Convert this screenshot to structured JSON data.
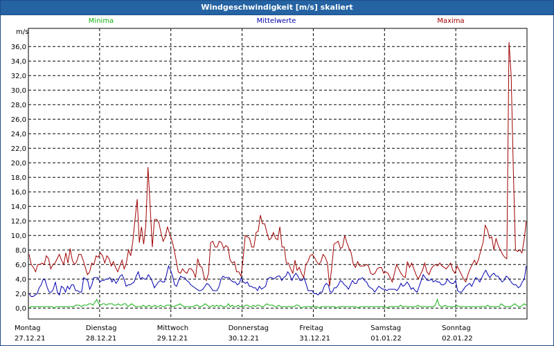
{
  "window": {
    "title": "Windgeschwindigkeit [m/s] skaliert"
  },
  "legend": {
    "minima": "Minima",
    "mittelwerte": "Mittelwerte",
    "maxima": "Maxima"
  },
  "colors": {
    "titlebar": "#2563a3",
    "minima": "#10b010",
    "mittelwerte": "#0000b0",
    "maxima": "#a00000",
    "grid": "#000000"
  },
  "chart_data": {
    "type": "line",
    "title": "Windgeschwindigkeit [m/s] skaliert",
    "ylabel": "m/s",
    "xlabel": "",
    "ylim": [
      -1.5,
      38.5
    ],
    "xlim": [
      0,
      7
    ],
    "yticks": [
      "0,0",
      "2,0",
      "4,0",
      "6,0",
      "8,0",
      "10,0",
      "12,0",
      "14,0",
      "16,0",
      "18,0",
      "20,0",
      "22,0",
      "24,0",
      "26,0",
      "28,0",
      "30,0",
      "32,0",
      "34,0",
      "36,0"
    ],
    "ytick_values": [
      0,
      2,
      4,
      6,
      8,
      10,
      12,
      14,
      16,
      18,
      20,
      22,
      24,
      26,
      28,
      30,
      32,
      34,
      36
    ],
    "grid": true,
    "days": [
      {
        "name": "Montag",
        "date": "27.12.21"
      },
      {
        "name": "Dienstag",
        "date": "28.12.21"
      },
      {
        "name": "Mittwoch",
        "date": "29.12.21"
      },
      {
        "name": "Donnerstag",
        "date": "30.12.21"
      },
      {
        "name": "Freitag",
        "date": "31.12.21"
      },
      {
        "name": "Samstag",
        "date": "01.01.22"
      },
      {
        "name": "Sonntag",
        "date": "02.01.22"
      }
    ],
    "series": [
      {
        "name": "Maxima",
        "color": "#a00000",
        "values": [
          7.4,
          6,
          5.6,
          5,
          6,
          6,
          6.2,
          6,
          7.2,
          6.8,
          5.4,
          6,
          6.2,
          6.8,
          7.4,
          6.6,
          6,
          7.6,
          6.2,
          8.2,
          6.6,
          6,
          6.4,
          7.4,
          7.4,
          6.6,
          5.6,
          4.6,
          5,
          6.2,
          6,
          7.2,
          7,
          7.6,
          7.2,
          6.2,
          7.2,
          6.8,
          5.8,
          6.4,
          5.6,
          5,
          5.8,
          6.6,
          5.4,
          6.2,
          8,
          7.2,
          9.2,
          12.2,
          15,
          9,
          11.2,
          8.8,
          11.4,
          19.4,
          14,
          8.4,
          12.2,
          12.2,
          11.8,
          10.4,
          9.2,
          9.8,
          11.2,
          10.2,
          9.4,
          8.2,
          6.6,
          5,
          4.8,
          5.4,
          5,
          4.8,
          5.4,
          5.4,
          5,
          4.2,
          6.8,
          5.8,
          5.6,
          4.2,
          3.8,
          4.8,
          9,
          9.2,
          8.4,
          8.4,
          9.2,
          9,
          8.2,
          8.6,
          8.4,
          6.6,
          6.2,
          6.4,
          5,
          5,
          4.4,
          6.8,
          10,
          9.8,
          9.6,
          8.4,
          8.4,
          10.4,
          10.6,
          12.8,
          11.6,
          11.6,
          10.4,
          9.4,
          9.6,
          10.4,
          9.6,
          9.4,
          11.2,
          8.4,
          8.4,
          6.2,
          6.2,
          5.4,
          4.8,
          6.6,
          5.2,
          5.6,
          4.8,
          4.2,
          6,
          6.4,
          7.2,
          7.4,
          7,
          6.4,
          6,
          6.4,
          7.4,
          7,
          6.2,
          3,
          5.6,
          8.8,
          9,
          9.2,
          8.2,
          8.4,
          10,
          9,
          8.2,
          7.6,
          6,
          5.6,
          6.4,
          5.8,
          5.8,
          5.8,
          6,
          5.8,
          4.8,
          4.6,
          4.8,
          5.4,
          5.6,
          5.6,
          4.8,
          5,
          4.8,
          4.2,
          3.6,
          4.8,
          6,
          5.4,
          4.8,
          4.4,
          4.2,
          6.4,
          5.6,
          6.2,
          5.4,
          4.6,
          4,
          4.6,
          5.2,
          6.2,
          5,
          4.6,
          5.4,
          5.8,
          6,
          5.8,
          6.2,
          5.8,
          5.6,
          5.4,
          5.8,
          6.2,
          5.2,
          4.8,
          5.8,
          5.2,
          4.6,
          4,
          3.6,
          4.6,
          5.4,
          6,
          6.6,
          6,
          6.8,
          8,
          9,
          11.4,
          10.8,
          9.6,
          9.8,
          8,
          9.6,
          8.6,
          8,
          7.4,
          7,
          6.8,
          36.6,
          32,
          19,
          8,
          7.8,
          8,
          7.6,
          9.4,
          12
        ]
      },
      {
        "name": "Mittelwerte",
        "color": "#0000b0",
        "values": [
          2,
          1.6,
          1.6,
          1.8,
          2,
          2.8,
          3.2,
          4,
          3.8,
          2.8,
          2.2,
          2.2,
          2.6,
          3.6,
          2.2,
          1.8,
          3,
          2.8,
          2.2,
          3,
          2.6,
          3.2,
          3.2,
          2.4,
          2.4,
          2.2,
          2.2,
          4.2,
          4,
          3.8,
          2.6,
          3.2,
          4.2,
          4.2,
          4.2,
          3.6,
          3.8,
          3.8,
          4,
          4,
          4.2,
          3.6,
          4,
          3.4,
          3.8,
          4.4,
          4.6,
          4,
          3,
          3.2,
          3.2,
          3.4,
          3.6,
          4.4,
          5,
          4,
          4.2,
          4,
          4,
          4.6,
          4.2,
          3.6,
          2.8,
          3.2,
          3.6,
          3.8,
          3.6,
          3.6,
          4.6,
          5.8,
          5.2,
          4.4,
          3.2,
          3,
          3.8,
          4.4,
          4.2,
          4.2,
          3.8,
          3.6,
          3.2,
          3,
          2.8,
          2.6,
          2.4,
          2.4,
          2.6,
          3,
          3.4,
          3.2,
          2.8,
          2.4,
          2.4,
          2.4,
          3,
          4,
          4.4,
          4.2,
          4.2,
          4.2,
          3.8,
          3.6,
          3.6,
          3.2,
          3.4,
          4.2,
          3.6,
          3.4,
          3.6,
          3,
          3,
          2.8,
          2.8,
          2.4,
          3,
          2.6,
          2.8,
          3,
          4,
          4.2,
          4.2,
          4,
          4.2,
          4.4,
          4.4,
          3.8,
          4.2,
          4.4,
          5,
          4.6,
          3.8,
          4.4,
          4.8,
          4.4,
          3.8,
          3.8,
          4.2,
          3.4,
          2.4,
          2.4,
          2.4,
          2,
          2,
          1.8,
          2.2,
          2.2,
          3,
          3.4,
          3.2,
          2.2,
          2.2,
          2.8,
          2.8,
          3.2,
          3.8,
          3.6,
          3.2,
          3,
          2.6,
          3.2,
          3.8,
          3.4,
          3.4,
          4,
          4,
          4.2,
          3.8,
          3.6,
          3,
          2.8,
          2.6,
          2.2,
          2.6,
          3,
          2.8,
          2.6,
          2.6,
          2.4,
          2.6,
          2.6,
          2.6,
          2.6,
          2.4,
          2.8,
          3.4,
          3,
          3.2,
          3.6,
          3.2,
          2.6,
          2.8,
          2.4,
          2.2,
          3,
          3.8,
          4.6,
          4.2,
          3.8,
          3.8,
          4,
          3.6,
          3.8,
          3.6,
          3.6,
          3.2,
          3.2,
          3.4,
          4,
          3.6,
          3.4,
          3.4,
          3.8,
          2.4,
          2.2,
          2.2,
          2.6,
          3,
          3.2,
          3.4,
          3,
          3.6,
          4.2,
          4,
          3.6,
          4.2,
          4.8,
          5.2,
          4.6,
          4.2,
          4.6,
          4.8,
          4.4,
          4.4,
          4,
          3.6,
          3.8,
          4.4,
          4.2,
          3.8,
          3.4,
          3.2,
          3.2,
          2.8,
          3,
          3.6,
          4,
          5.8
        ]
      },
      {
        "name": "Minima",
        "color": "#10b010",
        "values": [
          0,
          0.2,
          0.2,
          0.2,
          0.2,
          0.2,
          0.2,
          0.2,
          0.2,
          0.2,
          0.2,
          0.2,
          0.2,
          0,
          0.2,
          0.2,
          0.2,
          0.2,
          0.2,
          0.2,
          0.2,
          0.2,
          0.2,
          0.2,
          0.4,
          0.4,
          0.4,
          0.2,
          0.4,
          0.4,
          0.4,
          0.6,
          0.6,
          0.4,
          0.8,
          1.2,
          0.6,
          0.4,
          0.6,
          0.6,
          0.4,
          0.6,
          0.6,
          0.6,
          0.4,
          0.4,
          0.6,
          0.4,
          0.4,
          0.6,
          0.6,
          0.2,
          0.4,
          0.6,
          0.4,
          0.2,
          0.2,
          0.2,
          0.2,
          0.4,
          0.2,
          0.2,
          0.4,
          0.2,
          0.2,
          0.4,
          0.2,
          0.2,
          0.4,
          0.2,
          0.2,
          0.4,
          0.4,
          0.4,
          0.2,
          0.2,
          0.4,
          0.4,
          0.6,
          0.4,
          0.2,
          0.2,
          0.2,
          0.2,
          0.2,
          0.2,
          0.4,
          0.4,
          0.2,
          0.2,
          0.4,
          0.6,
          0.4,
          0.2,
          0.2,
          0.4,
          0.2,
          0.4,
          0.2,
          0.4,
          0.2,
          0.2,
          0.2,
          0.6,
          0.2,
          0.4,
          0.2,
          0.2,
          0.4,
          0.2,
          0.2,
          0.2,
          0.4,
          0.4,
          0.2,
          0.2,
          0.4,
          0.2,
          0.4,
          0.4,
          0.2,
          0.2,
          0.4,
          0.6,
          0.4,
          0.4,
          0.4,
          0.2,
          0.2,
          0.4,
          0.2,
          0.2,
          0.2,
          0.2,
          0.2,
          0.2,
          0.2,
          0.2,
          0.4,
          0.4,
          0.2,
          0,
          0.2,
          0.2,
          0.2,
          0.2,
          0.2,
          0.2,
          0.2,
          0.2,
          0,
          0.2,
          0.2,
          0.2,
          0.2,
          0.2,
          0.2,
          0.2,
          0.2,
          0,
          0.2,
          0.2,
          0.2,
          0.2,
          0.2,
          0.2,
          0.2,
          0.2,
          0.2,
          0.2,
          0,
          0.2,
          0.2,
          0.2,
          0.2,
          0.2,
          0.2,
          0.2,
          0.2,
          0.2,
          0.2,
          0.2,
          0.2,
          0.2,
          0.2,
          0,
          0.2,
          0.2,
          0.2,
          0.2,
          0.2,
          0.2,
          0.4,
          0.2,
          0.2,
          0.2,
          0.2,
          0.2,
          0.2,
          0.2,
          0.2,
          0.4,
          0.2,
          0.2,
          0.2,
          0.2,
          0.2,
          0.2,
          0.2,
          0.2,
          0.4,
          1.2,
          0.4,
          0.2,
          0.2,
          0.4,
          0.2,
          0.2,
          0.2,
          0.2,
          0.2,
          0.4,
          0.2,
          0.2,
          0.2,
          0.2,
          0.2,
          0.2,
          0.2,
          0.2,
          0.2,
          0.2,
          0.2,
          0.2,
          0.2,
          0.2,
          0.2,
          0.4,
          0.2,
          0.2,
          0.2,
          0.2,
          0.2,
          0.2,
          0.6,
          0.4,
          0.2,
          0.2,
          0.2,
          0.2,
          0.4,
          0.6,
          0.4,
          0.2,
          0.2,
          0.4,
          0.6,
          0.4
        ]
      }
    ]
  }
}
